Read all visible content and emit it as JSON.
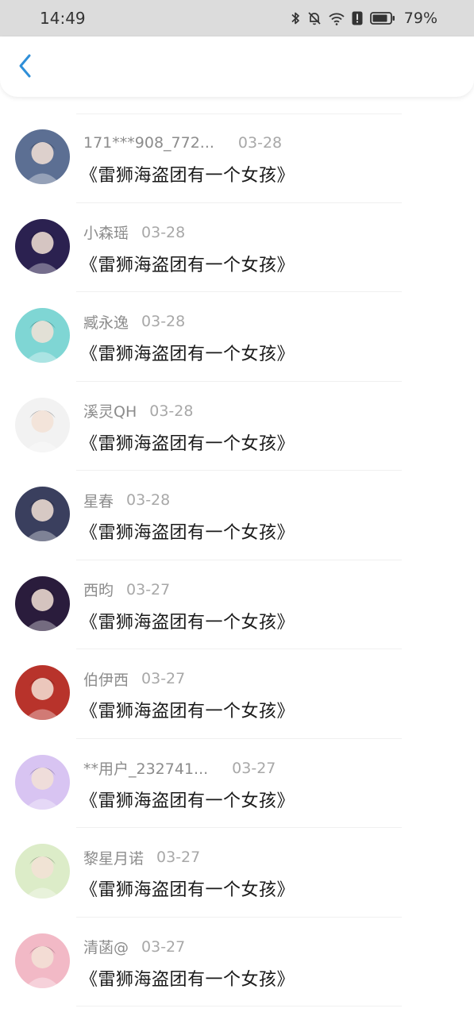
{
  "status_bar": {
    "time": "14:49",
    "battery": "79%",
    "icons": [
      "bluetooth-icon",
      "bell-muted-icon",
      "wifi-icon",
      "alert-icon",
      "battery-icon"
    ]
  },
  "nav": {
    "back_icon": "chevron-left-icon"
  },
  "colors": {
    "accent": "#2f8fd8",
    "status_bar_bg": "#dcdcdc"
  },
  "items": [
    {
      "name": "171***908_772...",
      "date": "03-28",
      "book": "《雷狮海盗团有一个女孩》",
      "avatar_color": "#5c6f93"
    },
    {
      "name": "小森瑶",
      "date": "03-28",
      "book": "《雷狮海盗团有一个女孩》",
      "avatar_color": "#2b2150"
    },
    {
      "name": "臧永逸",
      "date": "03-28",
      "book": "《雷狮海盗团有一个女孩》",
      "avatar_color": "#7fd6d4"
    },
    {
      "name": "溪灵QH",
      "date": "03-28",
      "book": "《雷狮海盗团有一个女孩》",
      "avatar_color": "#f2f2f2"
    },
    {
      "name": "星春",
      "date": "03-28",
      "book": "《雷狮海盗团有一个女孩》",
      "avatar_color": "#3a3f5e"
    },
    {
      "name": "西昀",
      "date": "03-27",
      "book": "《雷狮海盗团有一个女孩》",
      "avatar_color": "#2a1c3c"
    },
    {
      "name": "伯伊西",
      "date": "03-27",
      "book": "《雷狮海盗团有一个女孩》",
      "avatar_color": "#b8332b"
    },
    {
      "name": "**用户_232741...",
      "date": "03-27",
      "book": "《雷狮海盗团有一个女孩》",
      "avatar_color": "#d8c4f2"
    },
    {
      "name": "黎星月诺",
      "date": "03-27",
      "book": "《雷狮海盗团有一个女孩》",
      "avatar_color": "#dcecc8"
    },
    {
      "name": "清菡@",
      "date": "03-27",
      "book": "《雷狮海盗团有一个女孩》",
      "avatar_color": "#f2b9c6"
    }
  ]
}
